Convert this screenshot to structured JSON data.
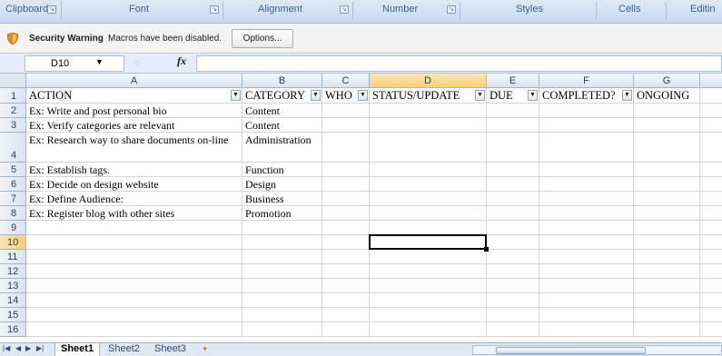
{
  "ribbon": {
    "groups": [
      {
        "label": "Clipboard"
      },
      {
        "label": "Font"
      },
      {
        "label": "Alignment"
      },
      {
        "label": "Number"
      },
      {
        "label": "Styles"
      },
      {
        "label": "Cells"
      },
      {
        "label": "Editin"
      }
    ]
  },
  "security_bar": {
    "title": "Security Warning",
    "message": "Macros have been disabled.",
    "options_label": "Options..."
  },
  "formula_bar": {
    "name_box": "D10",
    "fx_label": "fx",
    "formula": ""
  },
  "sheet": {
    "columns": [
      "A",
      "B",
      "C",
      "D",
      "E",
      "F",
      "G"
    ],
    "selected_column": "D",
    "selected_row": "10",
    "header_row": {
      "row_label": "1",
      "cells": [
        "ACTION",
        "CATEGORY",
        "WHO",
        "STATUS/UPDATE",
        "DUE",
        "COMPLETED?",
        "ONGOING"
      ]
    },
    "rows": [
      {
        "label": "2",
        "action": "Ex:  Write and post personal bio",
        "category": "Content"
      },
      {
        "label": "3",
        "action": "Ex:  Verify categories are relevant",
        "category": "Content"
      },
      {
        "label": "4",
        "action": "Ex:  Research way to share documents on-line",
        "category": "Administration"
      },
      {
        "label": "5",
        "action": "Ex:  Establish tags.",
        "category": "Function"
      },
      {
        "label": "6",
        "action": "Ex: Decide on design website",
        "category": "Design"
      },
      {
        "label": "7",
        "action": "Ex: Define Audience:",
        "category": "Business"
      },
      {
        "label": "8",
        "action": "Ex:  Register blog with other sites",
        "category": "Promotion"
      },
      {
        "label": "9",
        "action": "",
        "category": ""
      },
      {
        "label": "10",
        "action": "",
        "category": ""
      },
      {
        "label": "11",
        "action": "",
        "category": ""
      },
      {
        "label": "12",
        "action": "",
        "category": ""
      },
      {
        "label": "13",
        "action": "",
        "category": ""
      },
      {
        "label": "14",
        "action": "",
        "category": ""
      },
      {
        "label": "15",
        "action": "",
        "category": ""
      },
      {
        "label": "16",
        "action": "",
        "category": ""
      }
    ]
  },
  "tabs": {
    "sheets": [
      "Sheet1",
      "Sheet2",
      "Sheet3"
    ],
    "active": "Sheet1"
  },
  "colors": {
    "selection_header": "#f8cf78",
    "gridline": "#d4d4d4",
    "header_text": "#27415f"
  }
}
